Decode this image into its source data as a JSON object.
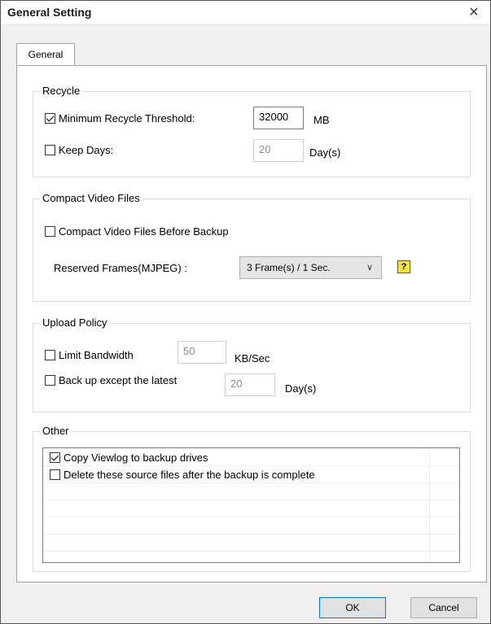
{
  "window": {
    "title": "General Setting",
    "close_glyph": "×"
  },
  "tabs": [
    {
      "label": "General"
    }
  ],
  "recycle": {
    "legend": "Recycle",
    "min_threshold": {
      "label": "Minimum Recycle Threshold:",
      "checked": true,
      "value": "32000",
      "unit": "MB"
    },
    "keep_days": {
      "label": "Keep Days:",
      "checked": false,
      "value": "20",
      "unit": "Day(s)"
    }
  },
  "compact": {
    "legend": "Compact Video Files",
    "before_backup": {
      "label": "Compact Video Files Before Backup",
      "checked": false
    },
    "reserved_frames": {
      "label": "Reserved Frames(MJPEG) :",
      "selected": "3 Frame(s) / 1 Sec."
    },
    "help_glyph": "?"
  },
  "upload": {
    "legend": "Upload Policy",
    "limit_bandwidth": {
      "label": "Limit Bandwidth",
      "checked": false,
      "value": "50",
      "unit": "KB/Sec"
    },
    "backup_except": {
      "label": "Back up except the latest",
      "checked": false,
      "value": "20",
      "unit": "Day(s)"
    }
  },
  "other": {
    "legend": "Other",
    "items": [
      {
        "label": "Copy Viewlog to backup drives",
        "checked": true
      },
      {
        "label": "Delete these source files after the backup is complete",
        "checked": false
      }
    ]
  },
  "buttons": {
    "ok": "OK",
    "cancel": "Cancel"
  }
}
